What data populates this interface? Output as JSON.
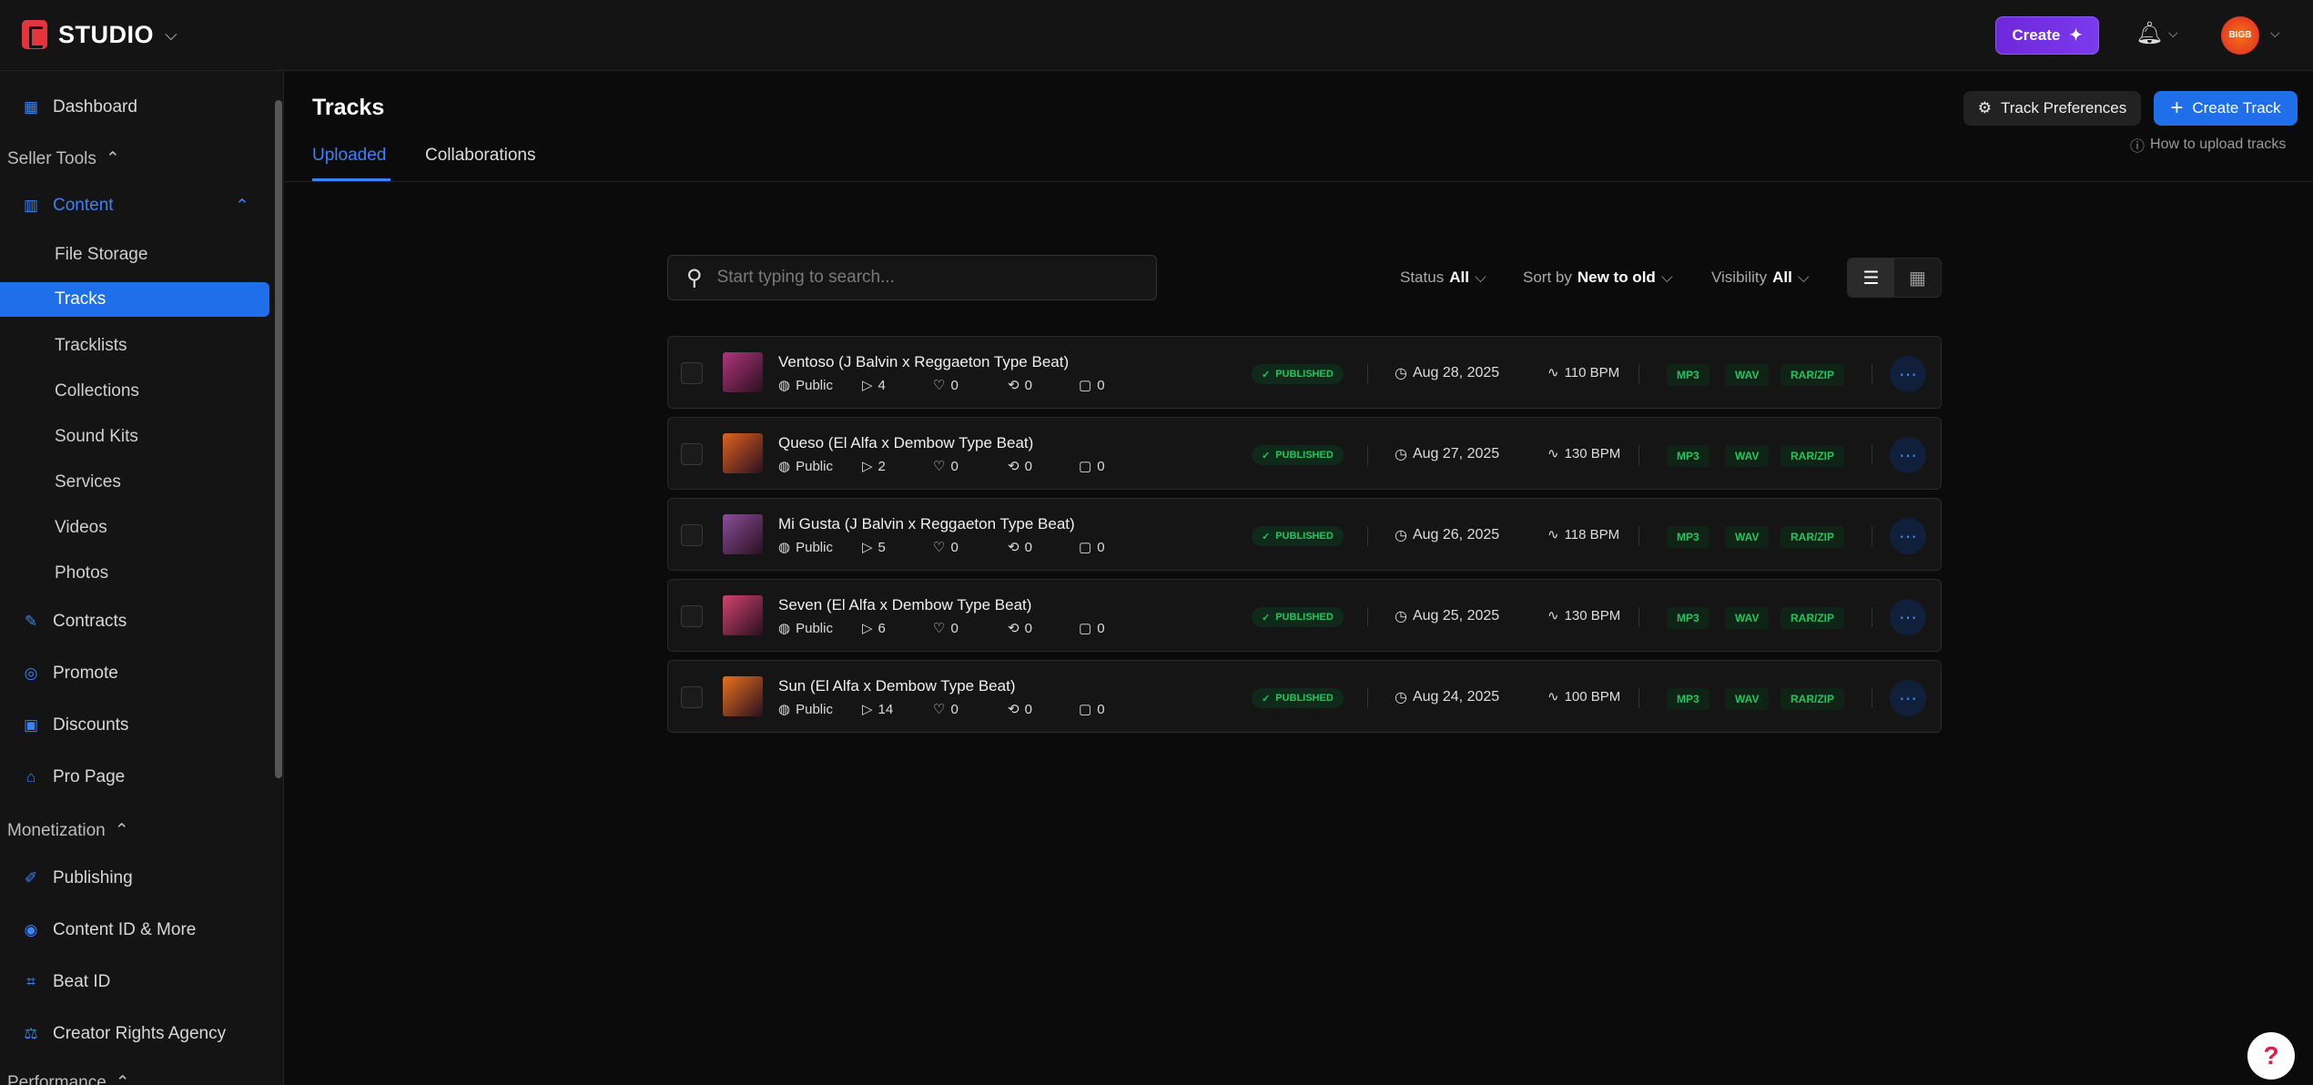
{
  "app": {
    "logo_text": "STUDIO"
  },
  "topbar": {
    "create_label": "Create",
    "avatar_text": "BIGB"
  },
  "sidebar": {
    "dashboard": "Dashboard",
    "seller_tools": "Seller Tools",
    "content": "Content",
    "content_items": [
      "File Storage",
      "Tracks",
      "Tracklists",
      "Collections",
      "Sound Kits",
      "Services",
      "Videos",
      "Photos"
    ],
    "seller_items": [
      "Contracts",
      "Promote",
      "Discounts",
      "Pro Page"
    ],
    "monetization": "Monetization",
    "monetization_items": [
      "Publishing",
      "Content ID & More",
      "Beat ID",
      "Creator Rights Agency"
    ],
    "performance_partial": "Performance"
  },
  "page": {
    "title": "Tracks",
    "tabs": [
      "Uploaded",
      "Collaborations"
    ],
    "track_prefs": "Track Preferences",
    "create_track": "Create Track",
    "howto": "How to upload tracks"
  },
  "toolbar": {
    "search_placeholder": "Start typing to search...",
    "status_label": "Status",
    "status_value": "All",
    "sort_label": "Sort by",
    "sort_value": "New to old",
    "visibility_label": "Visibility",
    "visibility_value": "All"
  },
  "tracks": [
    {
      "title": "Ventoso (J Balvin x Reggaeton Type Beat)",
      "visibility": "Public",
      "plays": "4",
      "likes": "0",
      "reposts": "0",
      "comments": "0",
      "status": "PUBLISHED",
      "date": "Aug 28, 2025",
      "bpm": "110 BPM",
      "formats": [
        "MP3",
        "WAV",
        "RAR/ZIP"
      ],
      "thumb": "#b0357a"
    },
    {
      "title": "Queso (El Alfa x Dembow Type Beat)",
      "visibility": "Public",
      "plays": "2",
      "likes": "0",
      "reposts": "0",
      "comments": "0",
      "status": "PUBLISHED",
      "date": "Aug 27, 2025",
      "bpm": "130 BPM",
      "formats": [
        "MP3",
        "WAV",
        "RAR/ZIP"
      ],
      "thumb": "#e0621d"
    },
    {
      "title": "Mi Gusta (J Balvin x Reggaeton Type Beat)",
      "visibility": "Public",
      "plays": "5",
      "likes": "0",
      "reposts": "0",
      "comments": "0",
      "status": "PUBLISHED",
      "date": "Aug 26, 2025",
      "bpm": "118 BPM",
      "formats": [
        "MP3",
        "WAV",
        "RAR/ZIP"
      ],
      "thumb": "#8a4d9a"
    },
    {
      "title": "Seven (El Alfa x Dembow Type Beat)",
      "visibility": "Public",
      "plays": "6",
      "likes": "0",
      "reposts": "0",
      "comments": "0",
      "status": "PUBLISHED",
      "date": "Aug 25, 2025",
      "bpm": "130 BPM",
      "formats": [
        "MP3",
        "WAV",
        "RAR/ZIP"
      ],
      "thumb": "#d0436e"
    },
    {
      "title": "Sun (El Alfa x Dembow Type Beat)",
      "visibility": "Public",
      "plays": "14",
      "likes": "0",
      "reposts": "0",
      "comments": "0",
      "status": "PUBLISHED",
      "date": "Aug 24, 2025",
      "bpm": "100 BPM",
      "formats": [
        "MP3",
        "WAV",
        "RAR/ZIP"
      ],
      "thumb": "#e9711d"
    }
  ],
  "help_label": "?"
}
